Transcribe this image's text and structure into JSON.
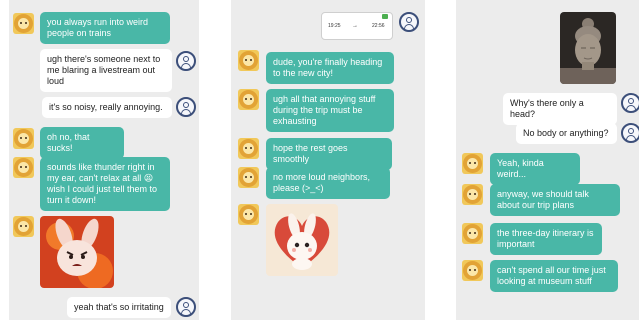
{
  "panel1": {
    "messages": [
      {
        "from": "bot",
        "text": "you always run into weird people on trains"
      },
      {
        "from": "user",
        "text": "ugh there's someone next to me blaring a livestream out loud"
      },
      {
        "from": "user",
        "text": "it's so noisy, really annoying."
      },
      {
        "from": "bot",
        "text": "oh no, that sucks!"
      },
      {
        "from": "bot",
        "text": "sounds like thunder right in my ear, can't relax at all 😫 wish I could just tell them to turn it down!"
      },
      {
        "from": "user",
        "text": "yeah that's so irritating"
      }
    ],
    "sticker": {
      "icon": "angry-bunny-sticker"
    }
  },
  "panel2": {
    "screenshot": {
      "time_left": "19:25",
      "time_right": "22:56",
      "icon": "phone-screenshot-icon"
    },
    "messages": [
      {
        "from": "bot",
        "text": "dude, you're finally heading to the new city!"
      },
      {
        "from": "bot",
        "text": "ugh all that annoying stuff during the trip must be exhausting"
      },
      {
        "from": "bot",
        "text": "hope the rest goes smoothly"
      },
      {
        "from": "bot",
        "text": "no more loud neighbors, please (>_<)"
      }
    ],
    "sticker": {
      "icon": "heart-bunny-sticker"
    }
  },
  "panel3": {
    "photo": {
      "icon": "buddha-head-photo"
    },
    "messages": [
      {
        "from": "user",
        "text": "Why's there only a head?"
      },
      {
        "from": "user",
        "text": "No body or anything?"
      },
      {
        "from": "bot",
        "text": "Yeah, kinda weird..."
      },
      {
        "from": "bot",
        "text": "anyway, we should talk about our trip plans"
      },
      {
        "from": "bot",
        "text": "the three-day itinerary is important"
      },
      {
        "from": "bot",
        "text": "can't spend all our time just looking at museum stuff"
      }
    ]
  },
  "colors": {
    "bot_bubble": "#49b7a7",
    "user_bubble": "#ffffff",
    "background": "#ececec"
  }
}
